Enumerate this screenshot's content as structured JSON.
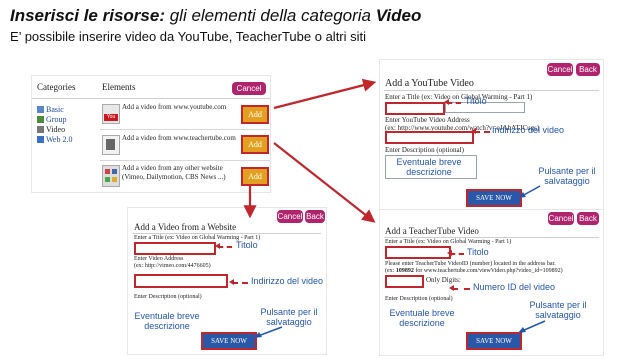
{
  "heading": {
    "title_bold": "Inserisci le risorse:",
    "title_rest": " gli elementi della categoria ",
    "title_bold2": "Video",
    "subtitle": "E’ possibile inserire video da YouTube, TeacherTube o altri siti"
  },
  "chooser": {
    "col_categories": "Categories",
    "col_elements": "Elements",
    "cancel": "Cancel",
    "categories": [
      "Basic",
      "Group",
      "Video",
      "Web 2.0"
    ],
    "rows": [
      {
        "text": "Add a video from www.youtube.com",
        "icon_text": "You",
        "add": "Add"
      },
      {
        "text": "Add a video from www.teachertube.com",
        "icon_text": "",
        "add": "Add"
      },
      {
        "text": "Add a video from any other website\n(Vimeo, Dailymotion, CBS News ...)",
        "icon_text": "",
        "add": "Add"
      }
    ]
  },
  "youtube_form": {
    "cancel": "Cancel",
    "back": "Back",
    "title": "Add a YouTube Video",
    "label_title": "Enter a Title (ex: Video on Global Warming - Part 1)",
    "label_address": "Enter YouTube Video Address",
    "label_address_ex": "(ex: http://www.youtube.com/watch?v=oJAbATJCugs)",
    "label_desc": "Enter Description (optional)",
    "save": "SAVE NOW",
    "ann_title": "Titolo",
    "ann_address": "Indirizzo del video",
    "ann_desc": "Eventuale breve descrizione",
    "ann_save": "Pulsante per il salvataggio"
  },
  "website_form": {
    "cancel": "Cancel",
    "back": "Back",
    "title": "Add a Video from a Website",
    "label_title": "Enter a Title (ex: Video on Global Warming - Part 1)",
    "label_address": "Enter Video Address",
    "label_address_ex": "(ex: http://vimeo.com/4476605)",
    "label_desc": "Enter Description (optional)",
    "save": "SAVE NOW",
    "ann_title": "Titolo",
    "ann_address": "Indirizzo del video",
    "ann_desc": "Eventuale breve descrizione",
    "ann_save": "Pulsante per il salvataggio"
  },
  "teachertube_form": {
    "cancel": "Cancel",
    "back": "Back",
    "title": "Add a TeacherTube Video",
    "label_title": "Enter a Title (ex: Video on Global Warming - Part 1)",
    "label_id": "Please enter TeacherTube VideoID (number) located in the address bar.",
    "label_id_ex_prefix": "(ex: ",
    "label_id_ex_bold": "109892",
    "label_id_ex_rest": " for www.teachertube.com/viewVideo.php?video_id=109892)",
    "only_digits": "Only Digits:",
    "label_desc": "Enter Description (optional)",
    "save": "SAVE NOW",
    "ann_title": "Titolo",
    "ann_id": "Numero ID del video",
    "ann_desc": "Eventuale breve descrizione",
    "ann_save": "Pulsante per il salvataggio"
  },
  "colors": {
    "accent": "#b0246e",
    "arrow": "#c0272d",
    "annotation": "#2356a8",
    "save": "#2a58a8",
    "add": "#e3a020"
  }
}
